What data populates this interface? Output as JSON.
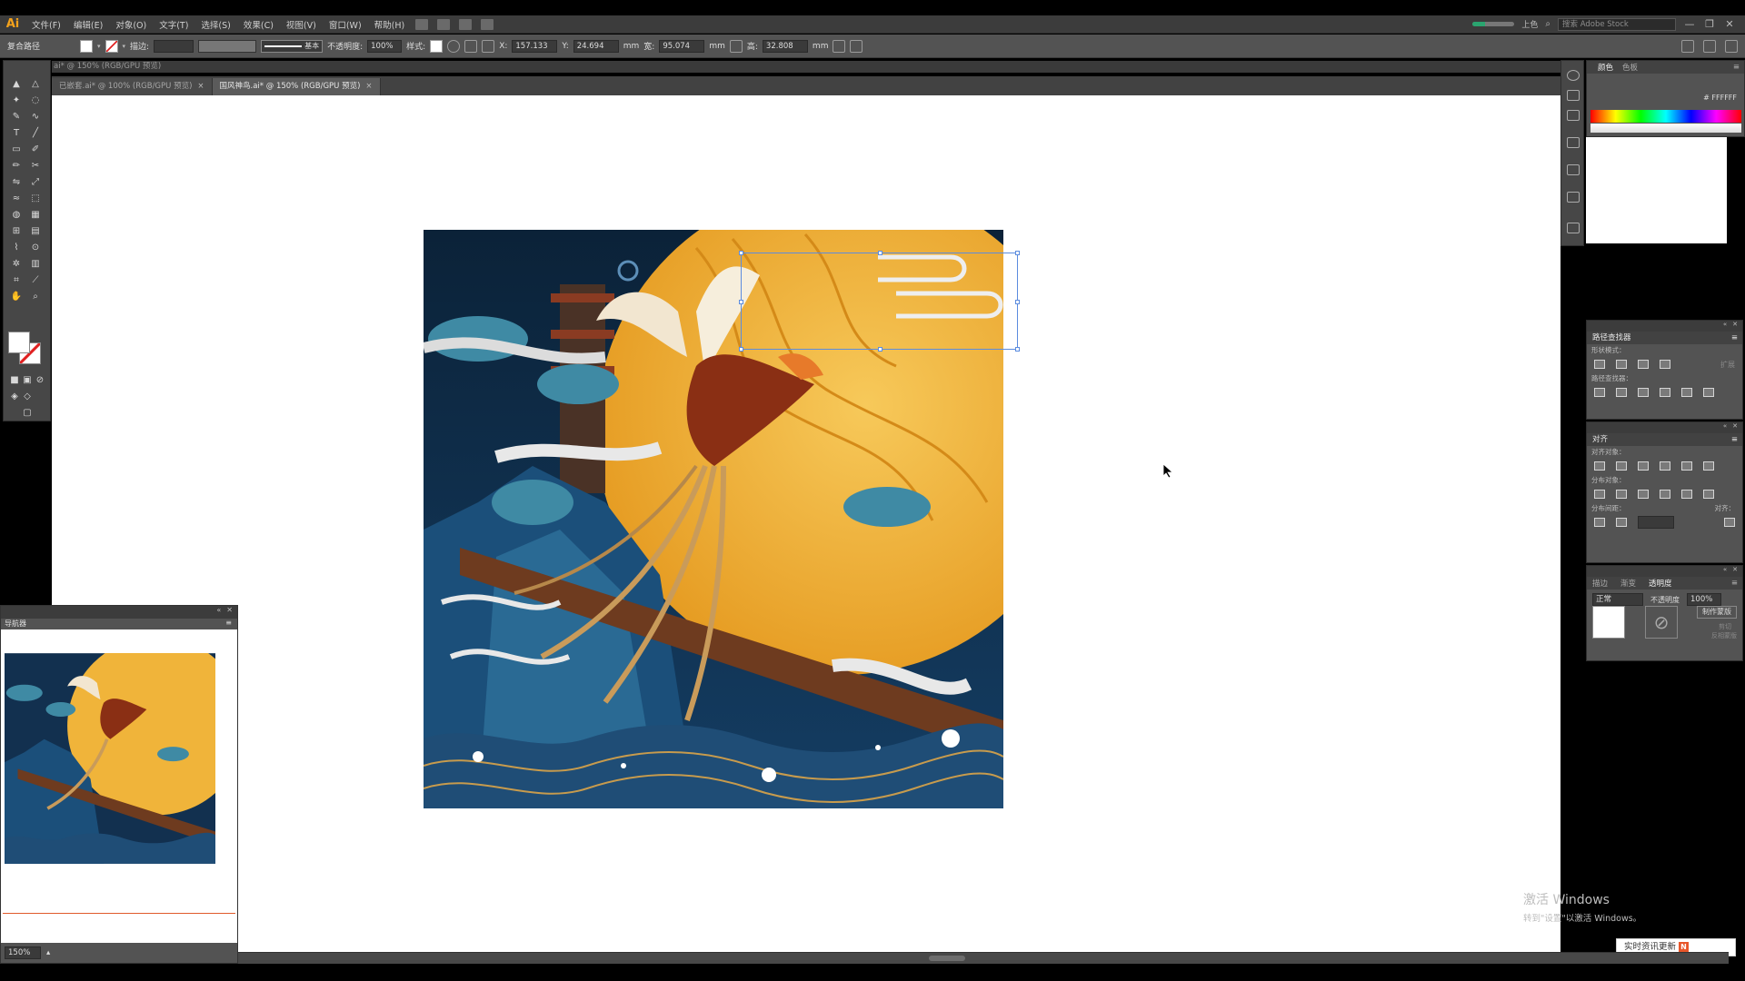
{
  "app": {
    "logo": "Ai"
  },
  "menu": {
    "items": [
      "文件(F)",
      "编辑(E)",
      "对象(O)",
      "文字(T)",
      "选择(S)",
      "效果(C)",
      "视图(V)",
      "窗口(W)",
      "帮助(H)"
    ],
    "workspace": "上色",
    "stock_search_placeholder": "搜索 Adobe Stock",
    "window_controls": [
      "—",
      "❐",
      "✕"
    ]
  },
  "control": {
    "selection_label": "复合路径",
    "stroke_label": "描边:",
    "brush_label": "基本",
    "opacity_label": "不透明度:",
    "opacity_value": "100%",
    "style_label": "样式:",
    "x_label": "X:",
    "x_value": "157.133",
    "y_label": "Y:",
    "y_value": "24.694",
    "w_label": "宽:",
    "w_value": "95.074",
    "h_label": "高:",
    "h_value": "32.808",
    "unit": "mm"
  },
  "doc_tabs": {
    "top_tab": "ai* @ 150% (RGB/GPU 预览)",
    "tabs": [
      {
        "label": "已嵌套.ai* @ 100% (RGB/GPU 预览)",
        "active": false
      },
      {
        "label": "国风神鸟.ai* @ 150% (RGB/GPU 预览)",
        "active": true
      }
    ],
    "close_symbol": "×"
  },
  "navigator": {
    "tab": "导航器",
    "zoom": "150%",
    "view_color": "#e05a2b"
  },
  "color_panel": {
    "tabs": [
      "颜色",
      "色板"
    ],
    "hex_label": "#",
    "hex_value": "FFFFFF"
  },
  "pathfinder_panel": {
    "title": "路径查找器",
    "shape_modes_label": "形状模式：",
    "expand_label": "扩展",
    "pathfinders_label": "路径查找器："
  },
  "align_panel": {
    "title": "对齐",
    "align_objects_label": "对齐对象：",
    "distribute_objects_label": "分布对象：",
    "distribute_spacing_label": "分布间距：",
    "align_to_label": "对齐："
  },
  "transparency_panel": {
    "tabs": [
      "描边",
      "渐变",
      "透明度"
    ],
    "blend_mode": "正常",
    "opacity_label": "不透明度",
    "opacity_value": "100%",
    "make_mask_label": "制作蒙版",
    "clip_label": "剪切",
    "invert_label": "反相蒙版"
  },
  "watermark": {
    "line1": "激活 Windows",
    "line2": "转到\"设置\"以激活 Windows。"
  },
  "notification": {
    "label": "实时资讯更新",
    "badge": "N"
  },
  "colors": {
    "accent": "#f4a21c",
    "selection": "#5b8cdf",
    "ui_dark": "#535353",
    "art_navy": "#12304f",
    "art_gold": "#f0b43a",
    "art_teal": "#3f8aa4"
  }
}
